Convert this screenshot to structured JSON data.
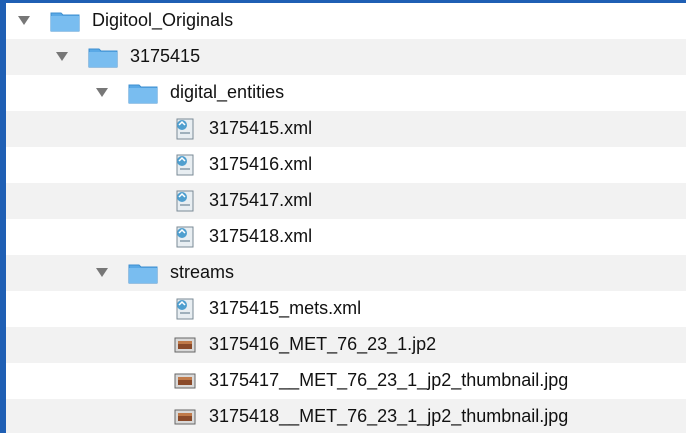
{
  "tree": {
    "root": {
      "label": "Digitool_Originals",
      "icon": "folder-icon",
      "expanded": true
    },
    "folder_3175415": {
      "label": "3175415",
      "icon": "folder-icon",
      "expanded": true
    },
    "folder_digital_entities": {
      "label": "digital_entities",
      "icon": "folder-icon",
      "expanded": true
    },
    "digital_entities_files": [
      {
        "label": "3175415.xml",
        "icon": "xml-file-icon"
      },
      {
        "label": "3175416.xml",
        "icon": "xml-file-icon"
      },
      {
        "label": "3175417.xml",
        "icon": "xml-file-icon"
      },
      {
        "label": "3175418.xml",
        "icon": "xml-file-icon"
      }
    ],
    "folder_streams": {
      "label": "streams",
      "icon": "folder-icon",
      "expanded": true
    },
    "streams_files": [
      {
        "label": "3175415_mets.xml",
        "icon": "xml-file-icon"
      },
      {
        "label": "3175416_MET_76_23_1.jp2",
        "icon": "image-file-icon"
      },
      {
        "label": "3175417__MET_76_23_1_jp2_thumbnail.jpg",
        "icon": "image-file-icon"
      },
      {
        "label": "3175418__MET_76_23_1_jp2_thumbnail.jpg",
        "icon": "image-file-icon"
      }
    ]
  },
  "colors": {
    "background_border": "#1f5fb4",
    "folder_blue": "#5aa9e6",
    "disclosure_triangle": "#777777"
  }
}
